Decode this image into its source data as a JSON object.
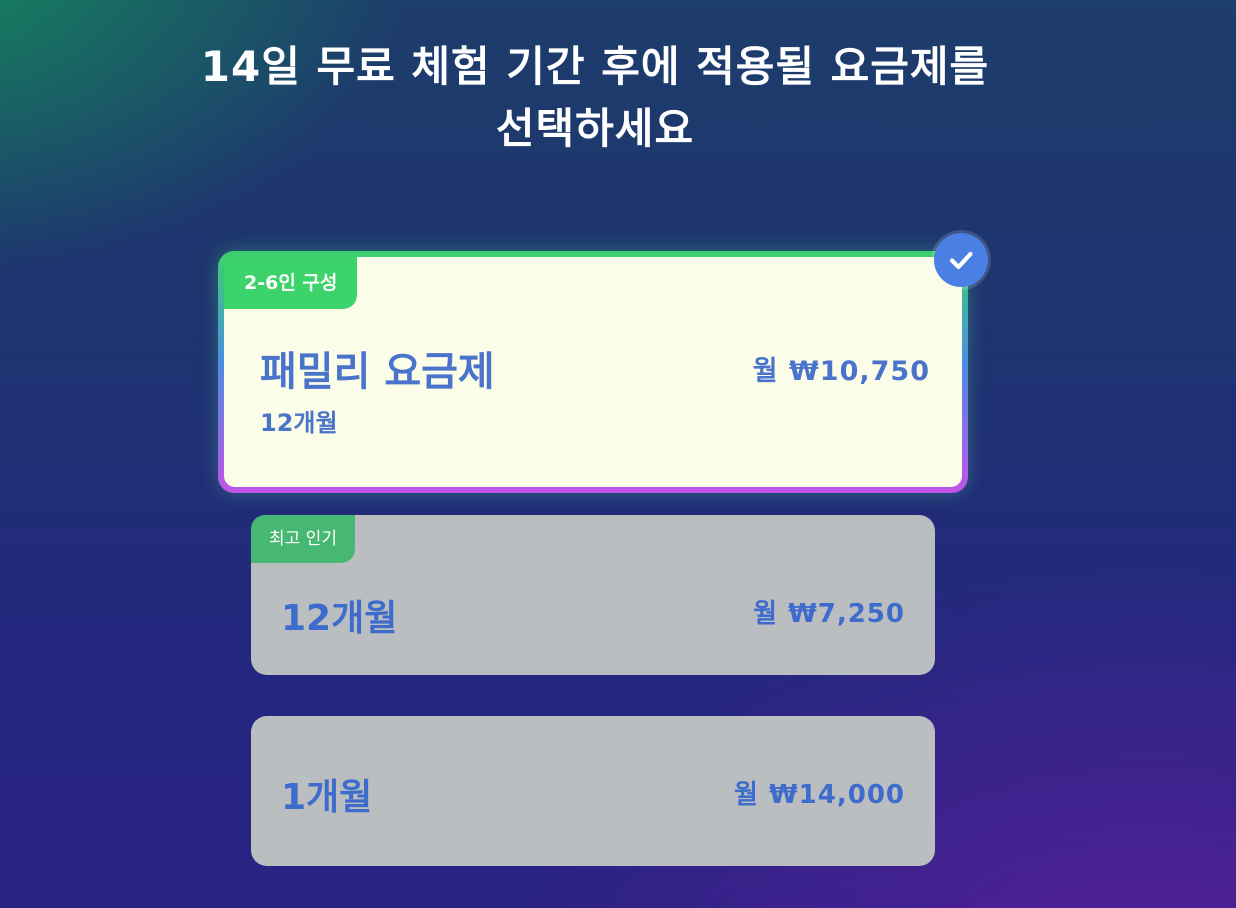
{
  "header": {
    "title_line1": "14일 무료 체험 기간 후에 적용될 요금제를",
    "title_line2": "선택하세요"
  },
  "plans": [
    {
      "badge": "2-6인 구성",
      "name": "패밀리 요금제",
      "sub": "12개월",
      "price": "월 ₩10,750",
      "selected": true
    },
    {
      "badge": "최고 인기",
      "name": "12개월",
      "price": "월 ₩7,250",
      "selected": false
    },
    {
      "name": "1개월",
      "price": "월 ₩14,000",
      "selected": false
    }
  ],
  "icons": {
    "selected_check": "checkmark-icon"
  },
  "colors": {
    "accent_green": "#3bd36a",
    "accent_blue": "#4a74cc",
    "check_blue": "#4a7fe4",
    "selected_card_bg": "#fbfde8",
    "unselected_card_bg": "#babec1"
  }
}
